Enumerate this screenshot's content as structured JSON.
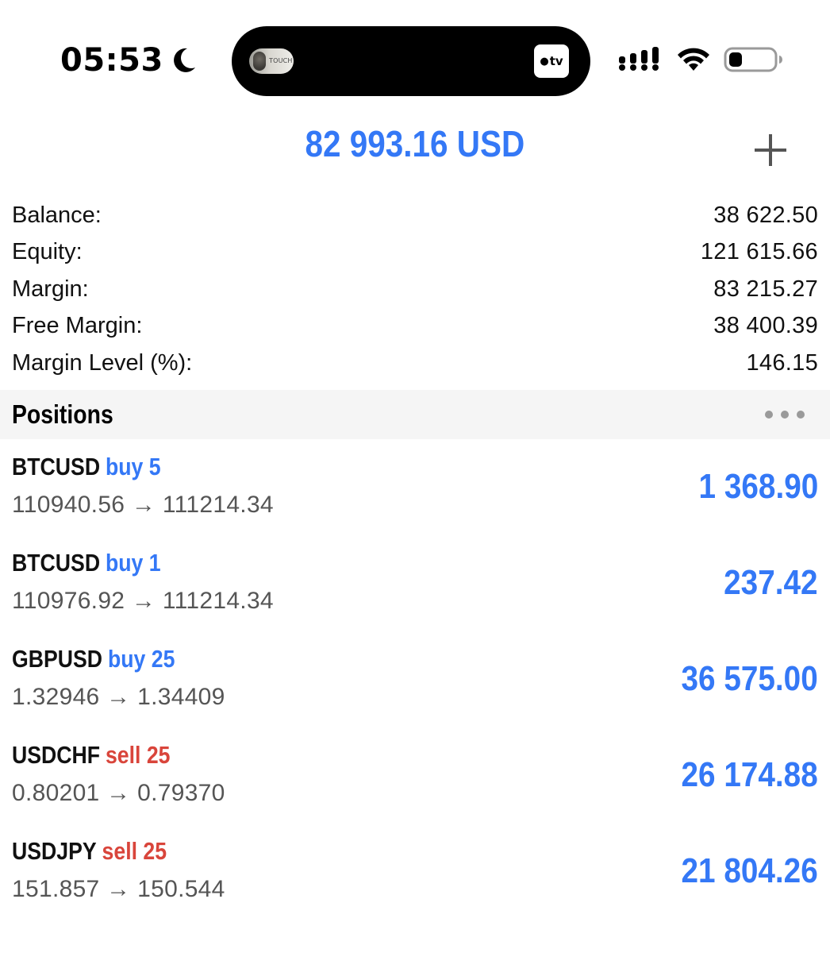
{
  "status_bar": {
    "time": "05:53",
    "island_thumb_text": "TOUCH",
    "appletv_label": "tv",
    "icons": [
      "moon-icon",
      "cellular-signal-icon",
      "wifi-icon",
      "battery-icon"
    ]
  },
  "header": {
    "title": "82 993.16 USD",
    "add_icon": "plus-icon",
    "accent_color": "#3478f6"
  },
  "summary": [
    {
      "label": "Balance:",
      "value": "38 622.50"
    },
    {
      "label": "Equity:",
      "value": "121 615.66"
    },
    {
      "label": "Margin:",
      "value": "83 215.27"
    },
    {
      "label": "Free Margin:",
      "value": "38 400.39"
    },
    {
      "label": "Margin Level (%):",
      "value": "146.15"
    }
  ],
  "positions": {
    "title": "Positions",
    "more_icon": "more-dots-icon",
    "items": [
      {
        "symbol": "BTCUSD",
        "side": "buy 5",
        "side_type": "buy",
        "prices": "110940.56 → 111214.34",
        "profit": "1 368.90"
      },
      {
        "symbol": "BTCUSD",
        "side": "buy 1",
        "side_type": "buy",
        "prices": "110976.92 → 111214.34",
        "profit": "237.42"
      },
      {
        "symbol": "GBPUSD",
        "side": "buy 25",
        "side_type": "buy",
        "prices": "1.32946 → 1.34409",
        "profit": "36 575.00"
      },
      {
        "symbol": "USDCHF",
        "side": "sell 25",
        "side_type": "sell",
        "prices": "0.80201 → 0.79370",
        "profit": "26 174.88"
      },
      {
        "symbol": "USDJPY",
        "side": "sell 25",
        "side_type": "sell",
        "prices": "151.857 → 150.544",
        "profit": "21 804.26"
      }
    ]
  },
  "colors": {
    "buy": "#3478f6",
    "sell": "#d9453b",
    "profit": "#3478f6"
  }
}
